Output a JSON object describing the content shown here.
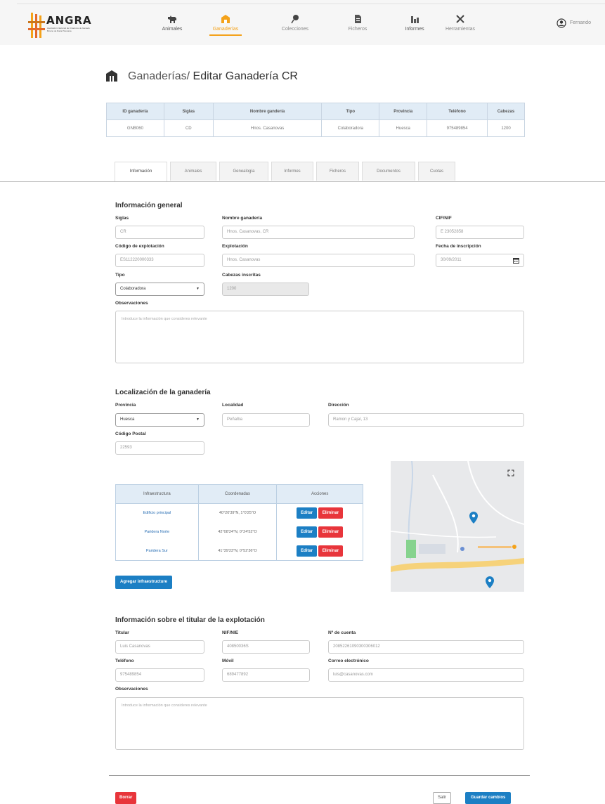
{
  "brand": {
    "name": "ANGRA",
    "tagline": "Asociación Nacional de Criadores de Ganado Bovino de Raza Pirenaica"
  },
  "nav": [
    {
      "label": "Animales",
      "icon": "cow-icon"
    },
    {
      "label": "Ganaderías",
      "icon": "barn-icon",
      "active": true
    },
    {
      "label": "Colecciones",
      "icon": "pin-icon"
    },
    {
      "label": "Ficheros",
      "icon": "file-icon"
    },
    {
      "label": "Informes",
      "icon": "bar-chart-icon"
    },
    {
      "label": "Herramientas",
      "icon": "tools-icon"
    }
  ],
  "user": {
    "name": "Fernando"
  },
  "breadcrumb": {
    "parent": "Ganaderías/",
    "current": "Editar Ganadería CR"
  },
  "summary": {
    "headers": [
      "ID ganadería",
      "Siglas",
      "Nombre gandería",
      "Tipo",
      "Provincia",
      "Teléfono",
      "Cabezas"
    ],
    "row": [
      "GNB060",
      "CD",
      "Hnos. Casanovas",
      "Colaboradora",
      "Huesca",
      "975489854",
      "1200"
    ]
  },
  "tabs": [
    "Información",
    "Animales",
    "Genealogía",
    "Informes",
    "Ficheros",
    "Documentos",
    "Cuotas"
  ],
  "general": {
    "title": "Información general",
    "siglas_label": "Siglas",
    "siglas": "CR",
    "nombre_label": "Nombre ganadería",
    "nombre": "Hnos. Casanovas, CR",
    "cif_label": "CIF/NIF",
    "cif": "E 23052858",
    "codigo_label": "Código de explotación",
    "codigo": "ES112220000333",
    "explotacion_label": "Explotación",
    "explotacion": "Hnos. Casanovas",
    "fecha_label": "Fecha de inscripción",
    "fecha": "30/09/2011",
    "tipo_label": "Tipo",
    "tipo": "Colaboradora",
    "cabezas_label": "Cabezas inscritas",
    "cabezas": "1200",
    "obs_label": "Observaciones",
    "obs_placeholder": "Introduce la información que consideres relevante"
  },
  "location": {
    "title": "Localización de la ganadería",
    "provincia_label": "Provincia",
    "provincia": "Huesca",
    "localidad_label": "Localidad",
    "localidad": "Peñalba",
    "direccion_label": "Dirección",
    "direccion": "Ramon y Cajal, 13",
    "cp_label": "Código Postal",
    "cp": "22593"
  },
  "infra": {
    "headers": [
      "Infraestructura",
      "Coordenadas",
      "Acciones"
    ],
    "rows": [
      {
        "name": "Edificio principal",
        "coords": "40°20'39\"N, 1°0'25\"O"
      },
      {
        "name": "Paridera Norte",
        "coords": "42°08'24\"N, 0°24'52\"O"
      },
      {
        "name": "Paridera Sur",
        "coords": "41°39'23\"N, 0°52'36\"O"
      }
    ],
    "edit_label": "Editar",
    "delete_label": "Eliminar",
    "add_label": "Agregar infraestructure"
  },
  "titular": {
    "title": "Información sobre el titular de la explotación",
    "titular_label": "Titular",
    "titular": "Luis Casanovas",
    "nif_label": "NIF/NIE",
    "nif": "40850036S",
    "cuenta_label": "Nº de cuenta",
    "cuenta": "20852261090300306012",
    "tel_label": "Teléfono",
    "tel": "975489854",
    "movil_label": "Móvil",
    "movil": "689477892",
    "email_label": "Correo electrónico",
    "email": "luis@casanovas.com",
    "obs_label": "Observaciones",
    "obs_placeholder": "Introduce la información que consideres relevante"
  },
  "footer": {
    "delete_label": "Borrar",
    "exit_label": "Salir",
    "save_label": "Guardar cambios"
  },
  "colors": {
    "accent": "#f4a21a",
    "primary": "#1c7fc4",
    "danger": "#e8353b"
  }
}
